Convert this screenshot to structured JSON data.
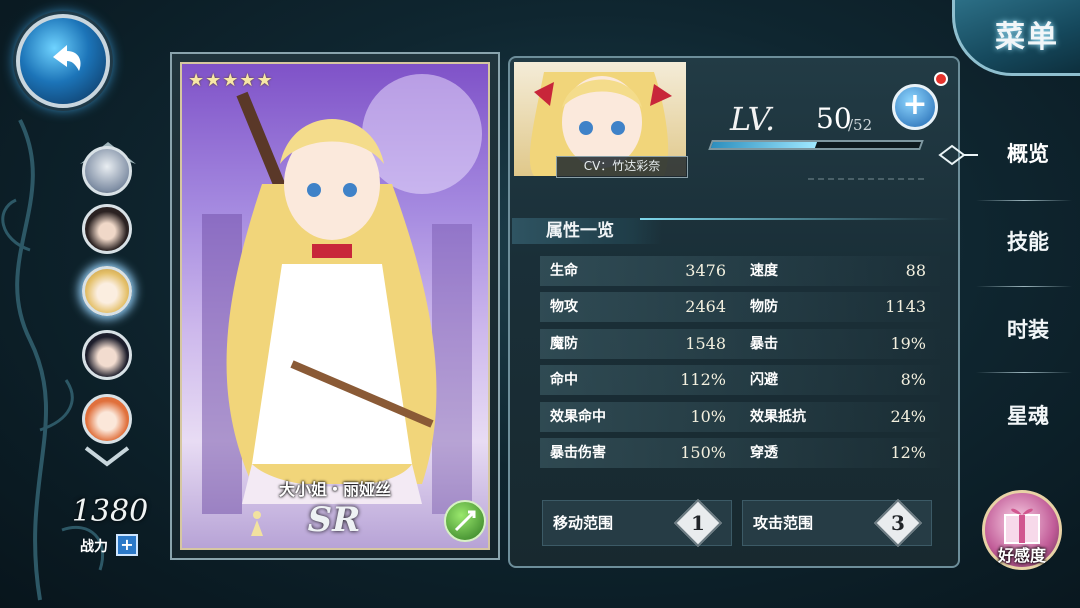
{
  "menu": {
    "label": "菜单"
  },
  "side_roster": {
    "avatars": [
      {
        "name": "avatar-1"
      },
      {
        "name": "avatar-2"
      },
      {
        "name": "avatar-3"
      },
      {
        "name": "avatar-4"
      },
      {
        "name": "avatar-5"
      }
    ],
    "power_value": "1380",
    "power_label": "战力",
    "power_plus": "+"
  },
  "card": {
    "stars": "★★★★★",
    "name": "大小姐・丽娅丝",
    "rarity": "SR"
  },
  "profile": {
    "cv": "CV：竹达彩奈",
    "level_label": "LV.",
    "level": "50",
    "level_max": "/52",
    "level_progress": 0.5,
    "level_plus": "+"
  },
  "attributes": {
    "header": "属性一览",
    "left": [
      {
        "name": "生命",
        "value": "3476"
      },
      {
        "name": "物攻",
        "value": "2464"
      },
      {
        "name": "魔防",
        "value": "1548"
      },
      {
        "name": "命中",
        "value": "112%"
      },
      {
        "name": "效果命中",
        "value": "10%"
      },
      {
        "name": "暴击伤害",
        "value": "150%"
      }
    ],
    "right": [
      {
        "name": "速度",
        "value": "88"
      },
      {
        "name": "物防",
        "value": "1143"
      },
      {
        "name": "暴击",
        "value": "19%"
      },
      {
        "name": "闪避",
        "value": "8%"
      },
      {
        "name": "效果抵抗",
        "value": "24%"
      },
      {
        "name": "穿透",
        "value": "12%"
      }
    ],
    "move_label": "移动范围",
    "move_value": "1",
    "attack_label": "攻击范围",
    "attack_value": "3"
  },
  "nav": {
    "overview": "概览",
    "skills": "技能",
    "outfit": "时装",
    "star_soul": "星魂",
    "affection": "好感度"
  },
  "colors": {
    "accent": "#7fd7ea",
    "panel": "#1a2f38",
    "alert": "#e5322c"
  }
}
